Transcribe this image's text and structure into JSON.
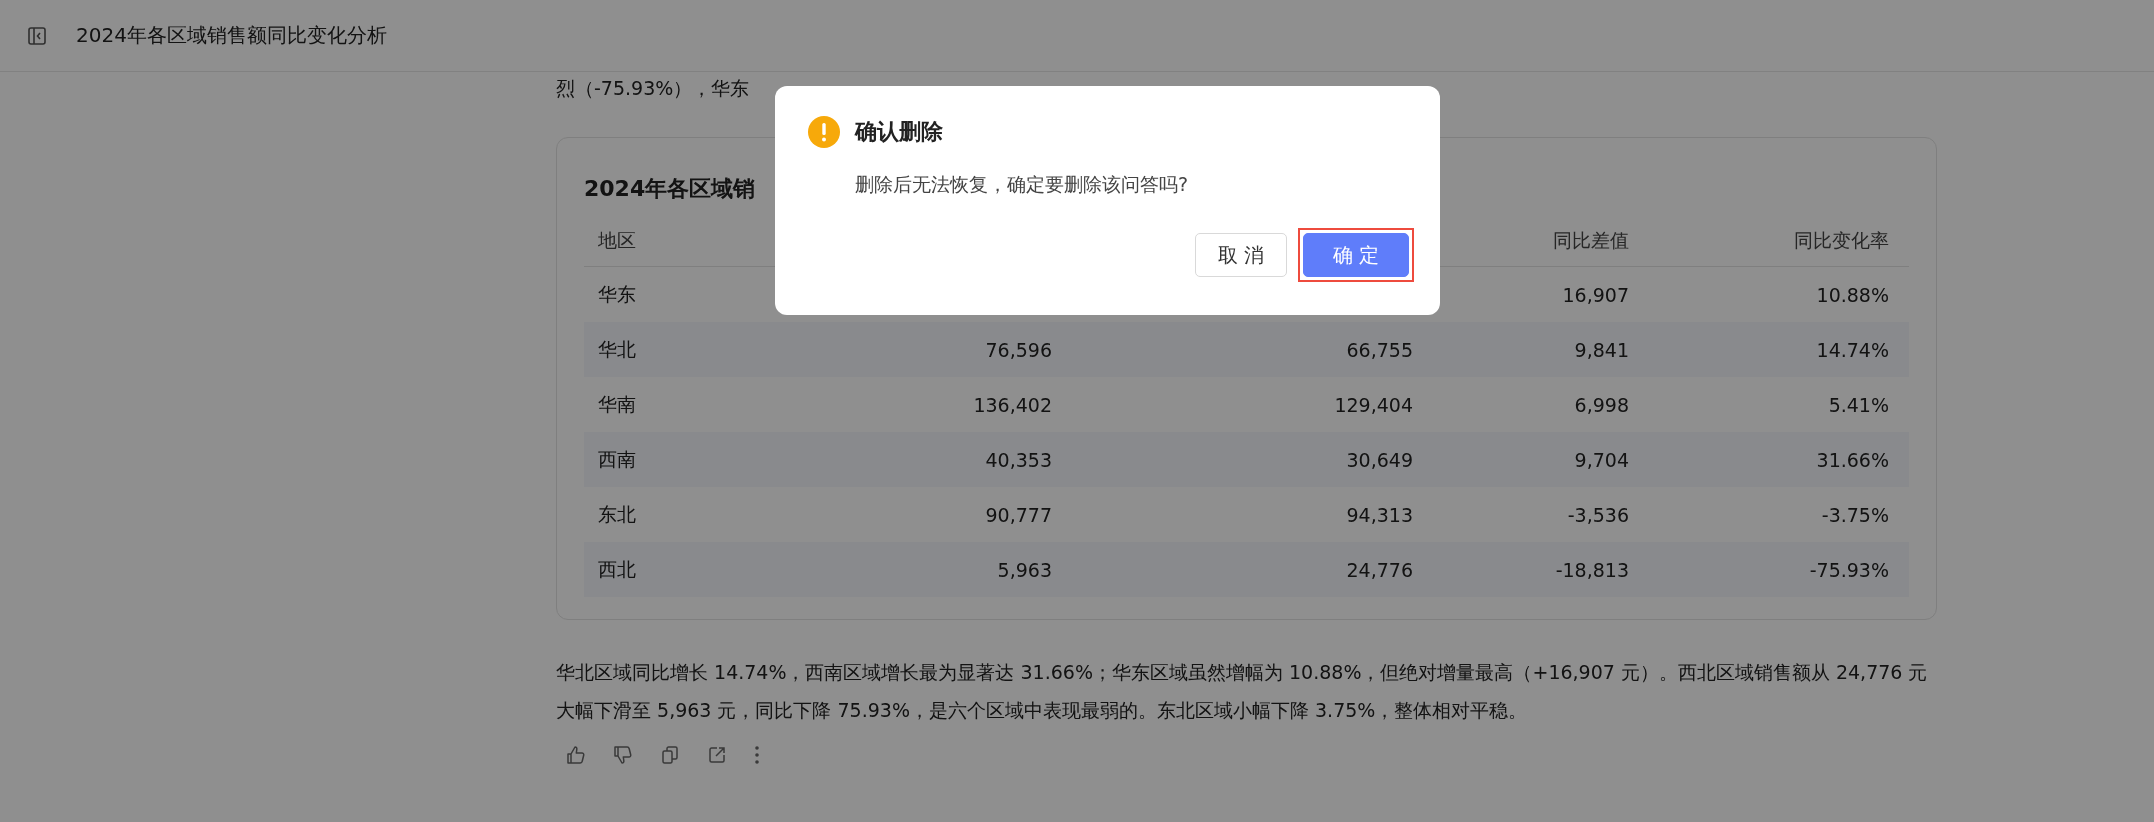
{
  "header": {
    "title": "2024年各区域销售额同比变化分析"
  },
  "intro_text": "烈（-75.93%），华东",
  "table": {
    "title": "2024年各区域销",
    "columns": [
      "地区",
      null,
      null,
      "同比差值",
      "同比变化率"
    ],
    "rows": [
      [
        "华东",
        null,
        null,
        "16,907",
        "10.88%"
      ],
      [
        "华北",
        "76,596",
        "66,755",
        "9,841",
        "14.74%"
      ],
      [
        "华南",
        "136,402",
        "129,404",
        "6,998",
        "5.41%"
      ],
      [
        "西南",
        "40,353",
        "30,649",
        "9,704",
        "31.66%"
      ],
      [
        "东北",
        "90,777",
        "94,313",
        "-3,536",
        "-3.75%"
      ],
      [
        "西北",
        "5,963",
        "24,776",
        "-18,813",
        "-75.93%"
      ]
    ]
  },
  "summary_text": "华北区域同比增长 14.74%，西南区域增长最为显著达 31.66%；华东区域虽然增幅为 10.88%，但绝对增量最高（+16,907 元）。西北区域销售额从 24,776 元大幅下滑至 5,963 元，同比下降 75.93%，是六个区域中表现最弱的。东北区域小幅下降 3.75%，整体相对平稳。",
  "actions": [
    {
      "kind": "like"
    },
    {
      "kind": "dislike"
    },
    {
      "kind": "copy"
    },
    {
      "kind": "share"
    },
    {
      "kind": "more"
    }
  ],
  "dialog": {
    "title": "确认删除",
    "message": "删除后无法恢复，确定要删除该问答吗?",
    "buttons": [
      {
        "label": "取 消",
        "kind": "secondary",
        "outlined": false
      },
      {
        "label": "确 定",
        "kind": "primary",
        "outlined": true
      }
    ]
  }
}
